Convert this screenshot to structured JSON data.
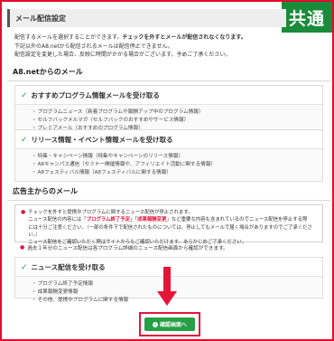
{
  "badge": "共通",
  "page_title": "メール配信設定",
  "intro": {
    "line1_prefix": "配信するメールを選択することができます。",
    "line1_bold": "チェックを外すとメールが配信されなくなります。",
    "line2": "下記以外のA8.netから配信されるメールは配信停止できません。",
    "line3": "配信設定を変更した場合、反映に時間がかかる場合がございます。予めご了承ください。"
  },
  "section_a8": {
    "title": "A8.netからのメール",
    "boxes": [
      {
        "head": "おすすめプログラム情報メールを受け取る",
        "items": [
          "プログラムニュース（新着プログラムや報酬アップ中のプログラム情報）",
          "セルフバックメルマガ（セルフバックのおすすめやサービス情報）",
          "プレミアメール（おすすめのプログラム情報）"
        ]
      },
      {
        "head": "リリース情報・イベント情報メールを受け取る",
        "items": [
          "特集・キャンペーン情報（特集やキャンペーンのリリース情報）",
          "A8キャンパス通信（セミナー開催情報や、アフィリエイト活動に関する情報）",
          "A8フェスティバル情報（A8フェスティバルに関する情報）"
        ]
      }
    ]
  },
  "section_adv": {
    "title": "広告主からのメール",
    "notice": {
      "line1": "チェックを外すと提携中プログラムに関するニュース配信が停止されます。",
      "line2_a": "ニュース配信の内容には「",
      "line2_red1": "プログラム終了予定",
      "line2_b": "」「",
      "line2_red2": "成果報酬変更",
      "line2_c": "」など重要な内容も含まれているのでニュース配信を停止する際",
      "line3": "には十分ご注意ください。（一部の条件下で配信されたものについては、停止してもメールで届く場合がありますのでご了承ください。）",
      "line4_prefix": "ニュース配信をご確認いただく際はサイトからもご確認いただけます。あらかじめご了承くださ",
      "line4_end": "い。"
    },
    "past_note": "過去１年分のニュース配信は各プログラム詳細のニュース配信画面から確認ができます。",
    "box": {
      "head": "ニュース配信を受け取る",
      "items": [
        "プログラム終了予定情報",
        "成果報酬変更情報",
        "その他、提携中プログラムに関する情報"
      ]
    }
  },
  "confirm_button": "確認画面へ",
  "colors": {
    "accent_red": "#e3163a",
    "green": "#27a045"
  }
}
